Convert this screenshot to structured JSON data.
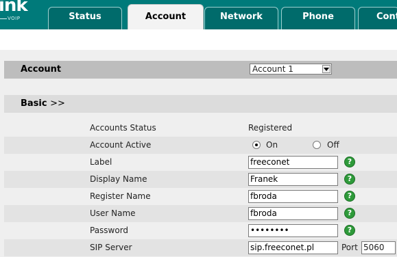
{
  "header": {
    "logo_text": "ink",
    "logo_sub": "VOIP",
    "tabs": [
      {
        "label": "Status",
        "active": false
      },
      {
        "label": "Account",
        "active": true
      },
      {
        "label": "Network",
        "active": false
      },
      {
        "label": "Phone",
        "active": false
      },
      {
        "label": "Cont",
        "active": false
      }
    ]
  },
  "account_section": {
    "title": "Account",
    "select_value": "Account 1"
  },
  "basic_section": {
    "label": "Basic",
    "arrows": ">>"
  },
  "rows": {
    "accounts_status": {
      "label": "Accounts Status",
      "value": "Registered"
    },
    "account_active": {
      "label": "Account Active",
      "on_label": "On",
      "off_label": "Off",
      "selected": "On"
    },
    "label": {
      "label": "Label",
      "value": "freeconet"
    },
    "display_name": {
      "label": "Display Name",
      "value": "Franek"
    },
    "register_name": {
      "label": "Register Name",
      "value": "fbroda"
    },
    "user_name": {
      "label": "User Name",
      "value": "fbroda"
    },
    "password": {
      "label": "Password",
      "value": "••••••••"
    },
    "sip_server": {
      "label": "SIP Server",
      "value": "sip.freeconet.pl",
      "port_label": "Port",
      "port_value": "5060"
    }
  },
  "help_icon_glyph": "?",
  "colors": {
    "header_bg": "#007a7a",
    "tab_bg": "#006b6b",
    "help_green": "#2e9a3a"
  }
}
